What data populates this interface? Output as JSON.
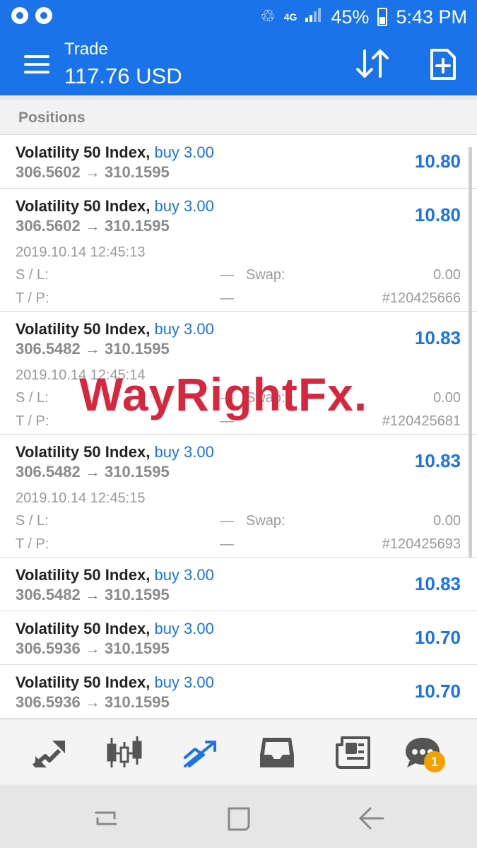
{
  "status_bar": {
    "battery": "45%",
    "time": "5:43 PM",
    "network": "4G"
  },
  "header": {
    "title": "Trade",
    "balance": "117.76 USD"
  },
  "section": {
    "title": "Positions"
  },
  "labels": {
    "sl": "S / L:",
    "tp": "T / P:",
    "swap": "Swap:",
    "dash": "—"
  },
  "positions": [
    {
      "symbol": "Volatility 50 Index,",
      "direction": "buy 3.00",
      "prices": "306.5602 → 310.1595",
      "profit": "10.80"
    },
    {
      "symbol": "Volatility 50 Index,",
      "direction": "buy 3.00",
      "prices": "306.5602 → 310.1595",
      "profit": "10.80",
      "time": "2019.10.14 12:45:13",
      "swap": "0.00",
      "ticket": "#120425666"
    },
    {
      "symbol": "Volatility 50 Index,",
      "direction": "buy 3.00",
      "prices": "306.5482 → 310.1595",
      "profit": "10.83",
      "time": "2019.10.14 12:45:14",
      "swap": "0.00",
      "ticket": "#120425681"
    },
    {
      "symbol": "Volatility 50 Index,",
      "direction": "buy 3.00",
      "prices": "306.5482 → 310.1595",
      "profit": "10.83",
      "time": "2019.10.14 12:45:15",
      "swap": "0.00",
      "ticket": "#120425693"
    },
    {
      "symbol": "Volatility 50 Index,",
      "direction": "buy 3.00",
      "prices": "306.5482 → 310.1595",
      "profit": "10.83"
    },
    {
      "symbol": "Volatility 50 Index,",
      "direction": "buy 3.00",
      "prices": "306.5936 → 310.1595",
      "profit": "10.70"
    },
    {
      "symbol": "Volatility 50 Index,",
      "direction": "buy 3.00",
      "prices": "306.5936 → 310.1595",
      "profit": "10.70"
    }
  ],
  "watermark": "WayRightFx.",
  "toolbar": {
    "icons": [
      "quotes-icon",
      "chart-icon",
      "trade-icon",
      "history-icon",
      "news-icon",
      "chat-icon"
    ],
    "active": "trade-icon",
    "chat_badge": "1"
  },
  "colors": {
    "accent": "#1a73e8",
    "watermark": "#d7263d",
    "badge": "#f5a000"
  }
}
